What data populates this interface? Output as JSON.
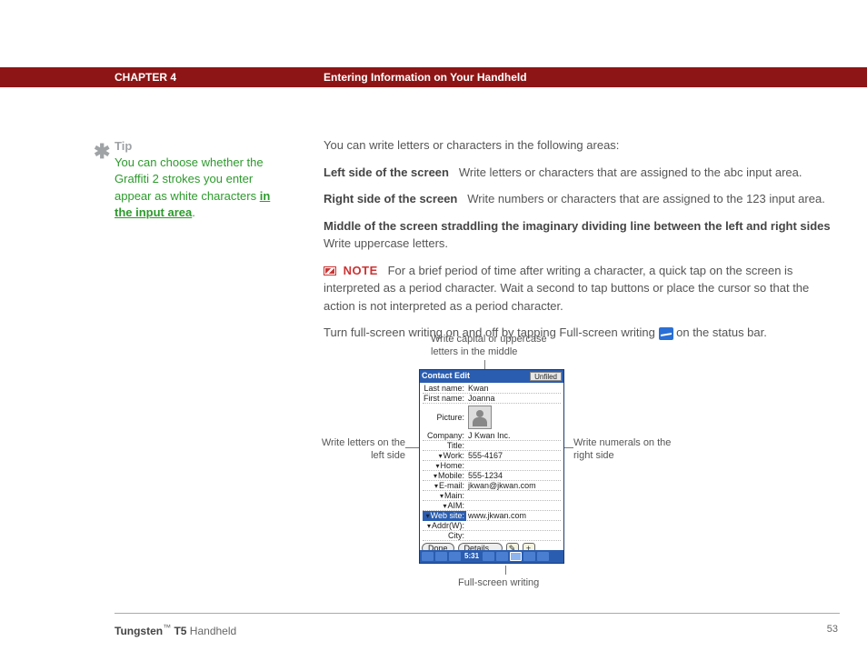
{
  "header": {
    "chapter": "CHAPTER 4",
    "title": "Entering Information on Your Handheld"
  },
  "tip": {
    "label": "Tip",
    "text_before": "You can choose whether the Graffiti 2 strokes you enter appear as white characters ",
    "link": "in the input area",
    "text_after": "."
  },
  "main": {
    "p1": "You can write letters or characters in the following areas:",
    "p2_bold": "Left side of the screen",
    "p2_rest": "Write letters or characters that are assigned to the abc input area.",
    "p3_bold": "Right side of the screen",
    "p3_rest": "Write numbers or characters that are assigned to the 123 input area.",
    "p4_bold": "Middle of the screen straddling the imaginary dividing line between the left and right sides",
    "p4_rest": "Write uppercase letters.",
    "note_label": "NOTE",
    "note_text": "For a brief period of time after writing a character, a quick tap on the screen is interpreted as a period character. Wait a second to tap buttons or place the cursor so that the action is not interpreted as a period character.",
    "p5_a": "Turn full-screen writing on and off by tapping Full-screen writing ",
    "p5_b": " on the status bar."
  },
  "callouts": {
    "top": "Write capital or uppercase letters in the middle",
    "left": "Write letters on the left side",
    "right": "Write numerals on the right side",
    "bottom": "Full-screen writing"
  },
  "device": {
    "title": "Contact Edit",
    "category": "Unfiled",
    "rows": {
      "last_name_lbl": "Last name:",
      "last_name_val": "Kwan",
      "first_name_lbl": "First name:",
      "first_name_val": "Joanna",
      "picture_lbl": "Picture:",
      "company_lbl": "Company:",
      "company_val": "J Kwan Inc.",
      "title_lbl": "Title:",
      "title_val": "",
      "work_lbl": "Work:",
      "work_val": "555-4167",
      "home_lbl": "Home:",
      "home_val": "",
      "mobile_lbl": "Mobile:",
      "mobile_val": "555-1234",
      "email_lbl": "E-mail:",
      "email_val": "jkwan@jkwan.com",
      "main_lbl": "Main:",
      "main_val": "",
      "aim_lbl": "AIM:",
      "aim_val": "",
      "website_lbl": "Web site:",
      "website_val": "www.jkwan.com",
      "addrw_lbl": "Addr(W):",
      "addrw_val": "",
      "city_lbl": "City:",
      "city_val": ""
    },
    "buttons": {
      "done": "Done",
      "details": "Details..."
    },
    "time": "5:31"
  },
  "footer": {
    "brand_bold": "Tungsten",
    "tm": "™",
    "brand_bold2": "T5",
    "brand_light": " Handheld"
  },
  "page": "53"
}
